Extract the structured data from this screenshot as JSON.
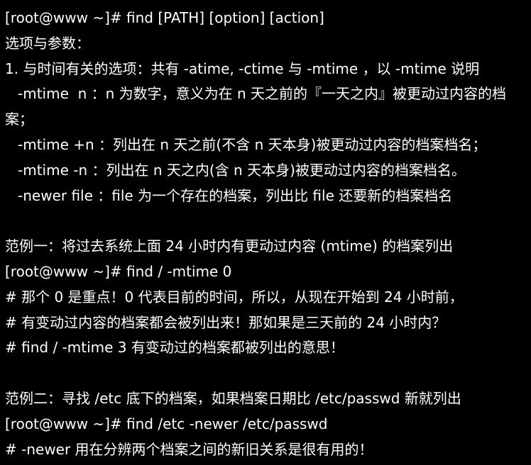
{
  "terminal": {
    "lines": [
      "[root@www ~]# find [PATH] [option] [action]",
      "选项与参数：",
      "1. 与时间有关的选项：共有 -atime, -ctime 与 -mtime ，以 -mtime 说明",
      "-mtime  n ：n 为数字，意义为在 n 天之前的『一天之内』被更动过内容的档",
      "案；",
      "-mtime +n ：列出在 n 天之前(不含 n 天本身)被更动过内容的档案档名；",
      "-mtime -n ：列出在 n 天之内(含 n 天本身)被更动过内容的档案档名。",
      "-newer file ：file 为一个存在的档案，列出比 file 还要新的档案档名",
      "",
      "范例一：将过去系统上面 24 小时内有更动过内容 (mtime) 的档案列出",
      "[root@www ~]# find / -mtime 0",
      "# 那个 0 是重点！0 代表目前的时间，所以，从现在开始到 24 小时前，",
      "# 有变动过内容的档案都会被列出来！那如果是三天前的 24 小时内？",
      "# find / -mtime 3 有变动过的档案都被列出的意思！",
      "",
      "范例二：寻找 /etc 底下的档案，如果档案日期比 /etc/passwd 新就列出",
      "[root@www ~]# find /etc -newer /etc/passwd",
      "# -newer 用在分辨两个档案之间的新旧关系是很有用的！"
    ]
  }
}
